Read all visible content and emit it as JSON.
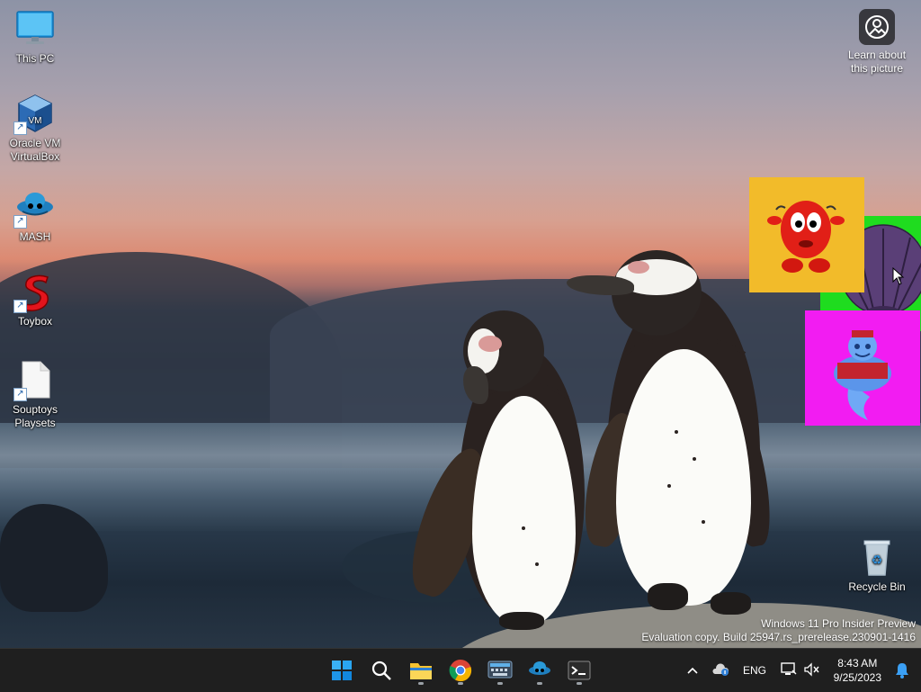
{
  "desktop": {
    "icons": [
      {
        "label": "This PC"
      },
      {
        "label": "Oracle VM VirtualBox"
      },
      {
        "label": "MASH"
      },
      {
        "label": "Toybox"
      },
      {
        "label": "Souptoys Playsets"
      },
      {
        "label": "Recycle Bin"
      }
    ],
    "learn_about_picture": "Learn about this picture",
    "watermark": {
      "line1": "Windows 11 Pro Insider Preview",
      "line2": "Evaluation copy. Build 25947.rs_prerelease.230901-1416"
    },
    "toys": [
      {
        "icon": "red-creature-icon",
        "bg": "#f2bb2a"
      },
      {
        "icon": "purple-shell-icon",
        "bg": "#1fdc1f"
      },
      {
        "icon": "genie-icon",
        "bg": "#f21cf2"
      }
    ]
  },
  "taskbar": {
    "apps": [
      {
        "icon": "windows-start-icon"
      },
      {
        "icon": "search-icon"
      },
      {
        "icon": "file-explorer-icon"
      },
      {
        "icon": "chrome-icon"
      },
      {
        "icon": "keyboard-app-icon"
      },
      {
        "icon": "mash-genie-icon"
      },
      {
        "icon": "terminal-icon"
      }
    ],
    "tray": {
      "language": "ENG",
      "time": "8:43 AM",
      "date": "9/25/2023"
    }
  },
  "colors": {
    "taskbar_bg": "#1f1f1f",
    "accent": "#0a84ff"
  }
}
